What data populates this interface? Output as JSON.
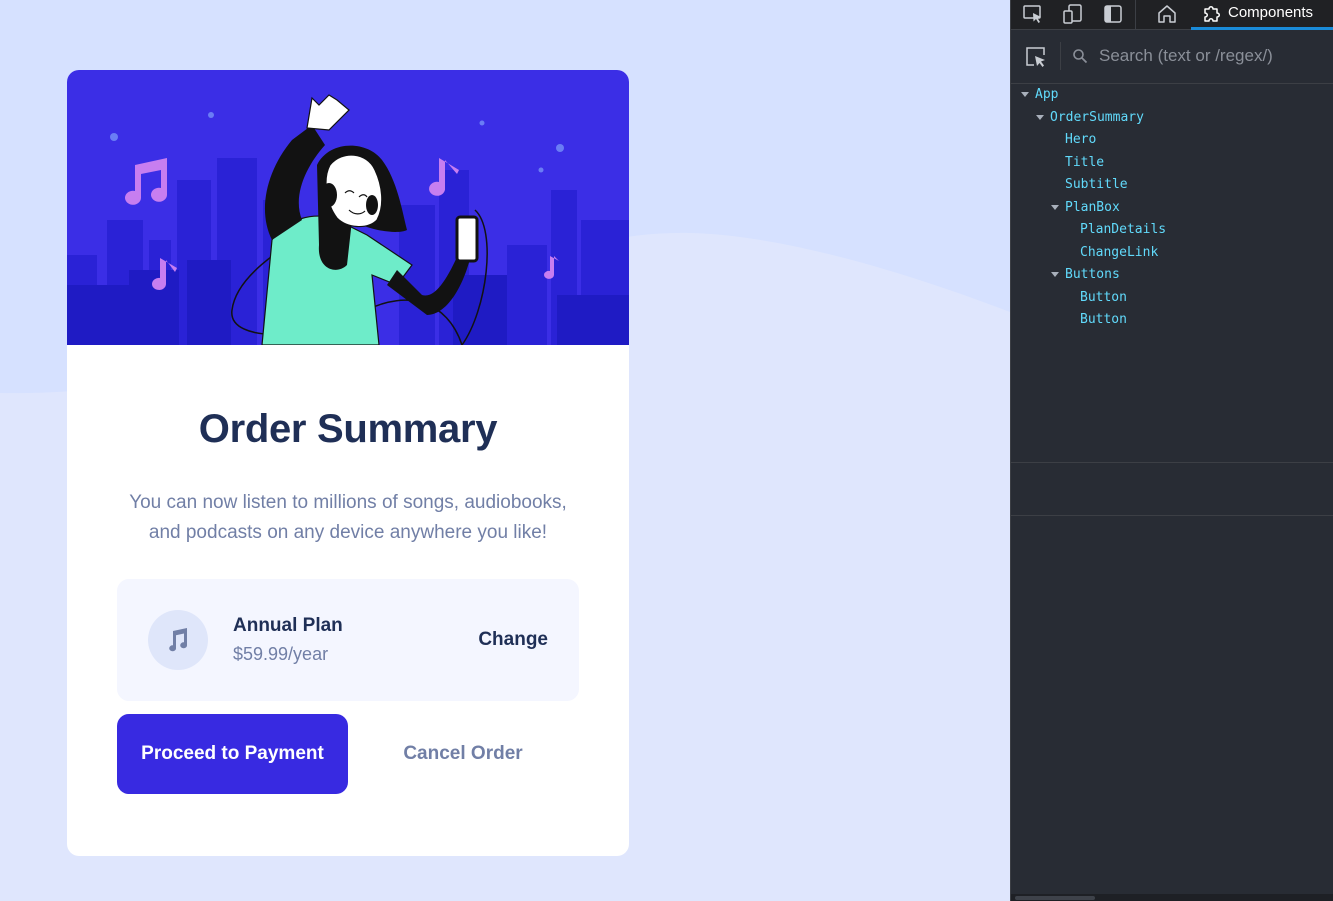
{
  "app": {
    "title": "Order Summary",
    "subtitle": "You can now listen to millions of songs, audiobooks, and podcasts on any device anywhere you like!",
    "plan": {
      "name": "Annual Plan",
      "price": "$59.99/year",
      "change_label": "Change",
      "icon": "music-note-icon"
    },
    "buttons": {
      "proceed_label": "Proceed to Payment",
      "cancel_label": "Cancel Order"
    },
    "colors": {
      "page_background": "#d6e1fe",
      "hero_background": "#3b2ee6",
      "primary_button": "#382ae1",
      "heading_text": "#1f2f56",
      "muted_text": "#717fa6",
      "plan_box": "#f4f6ff"
    }
  },
  "devtools": {
    "toolbar": {
      "icons": [
        "inspect-element-icon",
        "device-toolbar-icon",
        "toggle-sidebar-icon",
        "home-icon"
      ],
      "active_tab": {
        "label": "Components",
        "icon": "components-puzzle-icon"
      }
    },
    "search": {
      "placeholder": "Search (text or /regex/)",
      "value": ""
    },
    "tree": [
      {
        "label": "App",
        "depth": 0,
        "expanded": true
      },
      {
        "label": "OrderSummary",
        "depth": 1,
        "expanded": true
      },
      {
        "label": "Hero",
        "depth": 2
      },
      {
        "label": "Title",
        "depth": 2
      },
      {
        "label": "Subtitle",
        "depth": 2
      },
      {
        "label": "PlanBox",
        "depth": 2,
        "expanded": true
      },
      {
        "label": "PlanDetails",
        "depth": 3
      },
      {
        "label": "ChangeLink",
        "depth": 3
      },
      {
        "label": "Buttons",
        "depth": 2,
        "expanded": true
      },
      {
        "label": "Button",
        "depth": 3
      },
      {
        "label": "Button",
        "depth": 3
      }
    ],
    "colors": {
      "panel_background": "#282c34",
      "component_name": "#61dafb",
      "active_tab_underline": "#1a8bd8"
    }
  }
}
